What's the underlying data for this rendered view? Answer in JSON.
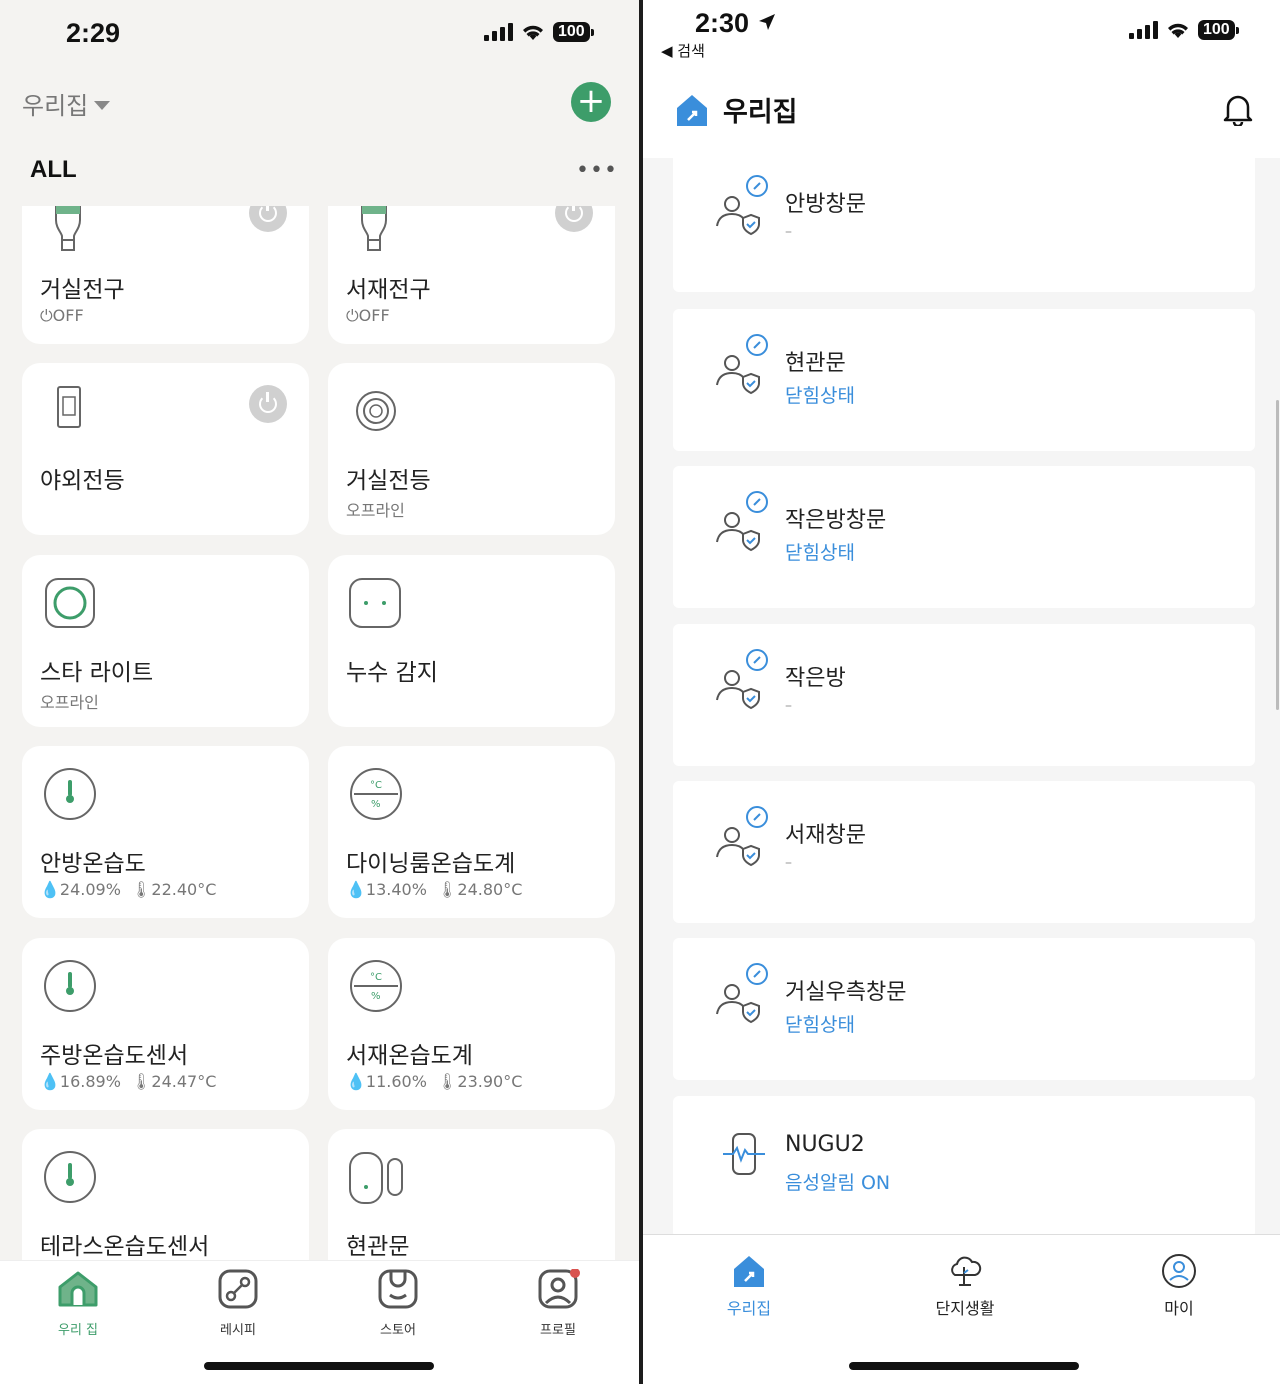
{
  "left": {
    "status_bar": {
      "time": "2:29",
      "battery": "100"
    },
    "home_selector": "우리집",
    "section_title": "ALL",
    "more_label": "•••",
    "devices": [
      {
        "name": "거실전구",
        "status": "⏻OFF"
      },
      {
        "name": "서재전구",
        "status": "⏻OFF"
      },
      {
        "name": "야외전등",
        "status": ""
      },
      {
        "name": "거실전등",
        "status": "오프라인"
      },
      {
        "name": "스타 라이트",
        "status": "오프라인"
      },
      {
        "name": "누수 감지",
        "status": ""
      },
      {
        "name": "안방온습도",
        "status": "💧24.09%   🌡22.40°C",
        "humidity": "24.09%",
        "temp": "22.40°C"
      },
      {
        "name": "다이닝룸온습도계",
        "humidity": "13.40%",
        "temp": "24.80°C"
      },
      {
        "name": "주방온습도센서",
        "humidity": "16.89%",
        "temp": "24.47°C"
      },
      {
        "name": "서재온습도계",
        "humidity": "11.60%",
        "temp": "23.90°C"
      },
      {
        "name": "테라스온습도센서"
      },
      {
        "name": "현관문"
      }
    ],
    "tabs": [
      {
        "label": "우리 집"
      },
      {
        "label": "레시피"
      },
      {
        "label": "스토어"
      },
      {
        "label": "프로필"
      }
    ],
    "colors": {
      "accent": "#3d9d6a",
      "background": "#f4f3f1"
    }
  },
  "right": {
    "status_bar": {
      "time": "2:30",
      "battery": "100",
      "back_label": "◀ 검색"
    },
    "header_title": "우리집",
    "devices": [
      {
        "name": "안방창문",
        "status": "–"
      },
      {
        "name": "현관문",
        "status": "닫힘상태"
      },
      {
        "name": "작은방창문",
        "status": "닫힘상태"
      },
      {
        "name": "작은방",
        "status": "–"
      },
      {
        "name": "서재창문",
        "status": "–"
      },
      {
        "name": "거실우측창문",
        "status": "닫힘상태"
      },
      {
        "name": "NUGU2",
        "status": "음성알림 ON"
      }
    ],
    "tabs": [
      {
        "label": "우리집"
      },
      {
        "label": "단지생활"
      },
      {
        "label": "마이"
      }
    ],
    "colors": {
      "accent": "#3a8edb"
    }
  }
}
